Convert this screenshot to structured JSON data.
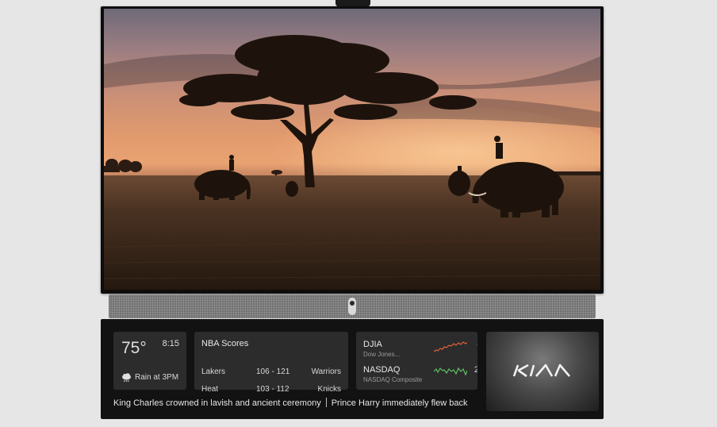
{
  "weather": {
    "temperature": "75°",
    "time": "8:15",
    "forecast": "Rain at 3PM",
    "icon": "rain-cloud-icon"
  },
  "scores": {
    "title": "NBA Scores",
    "games": [
      {
        "home": "Lakers",
        "score": "106 - 121",
        "away": "Warriors"
      },
      {
        "home": "Heat",
        "score": "103 - 112",
        "away": "Knicks"
      }
    ]
  },
  "stocks": {
    "items": [
      {
        "symbol": "DJIA",
        "name": "Dow Jones...",
        "trend_color": "#e0603a",
        "clipped": ""
      },
      {
        "symbol": "NASDAQ",
        "name": "NASDAQ Composite",
        "trend_color": "#5fbf62",
        "clipped": "2"
      }
    ]
  },
  "ad": {
    "brand": "KIA",
    "logo": "kia-logo"
  },
  "ticker": {
    "headlines": [
      "King Charles crowned in lavish and ancient ceremony",
      "Prince Harry immediately flew back"
    ]
  },
  "colors": {
    "panel_bg": "#121212",
    "card_bg": "#2c2c2c",
    "soundbar": "#6c6c6c",
    "frame": "#0d0d0d"
  }
}
